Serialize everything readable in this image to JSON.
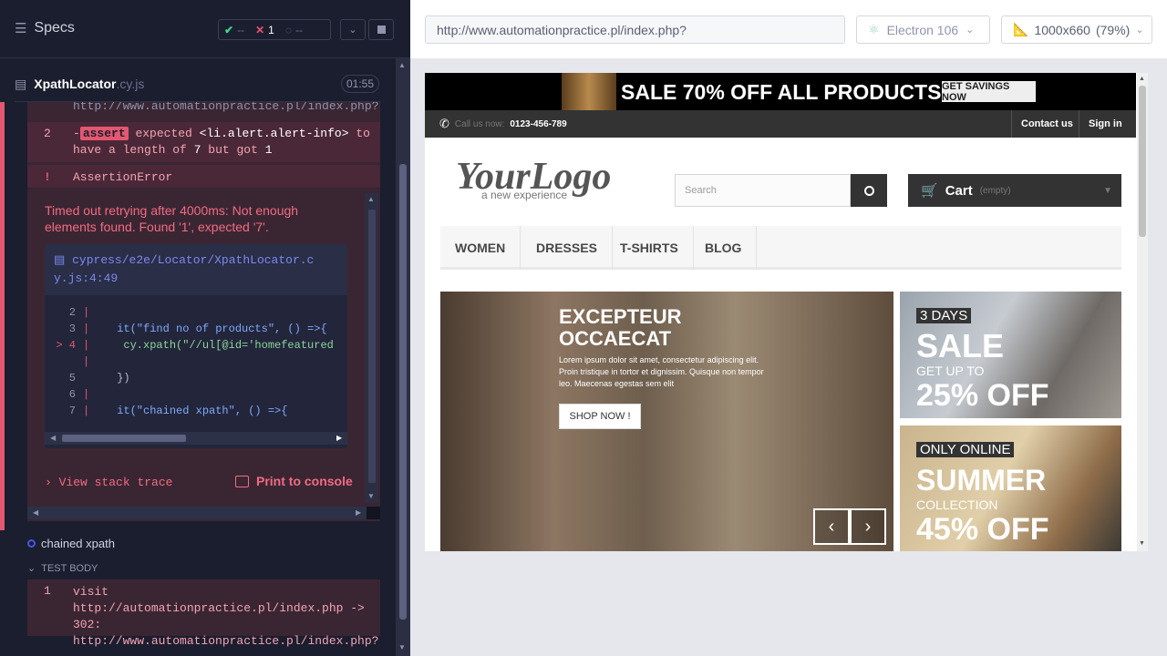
{
  "header": {
    "specs_label": "Specs",
    "passed": "--",
    "failed": "1",
    "pending": "--"
  },
  "spec_file": {
    "name": "XpathLocator",
    "ext": ".cy.js",
    "duration": "01:55"
  },
  "command_log": {
    "visit_prev_text": "http://www.automationpractice.pl/index.php?",
    "assert_row": {
      "num": "2",
      "prefix": "-",
      "badge": "assert",
      "text1": "expected",
      "selector": "<li.alert.alert-info>",
      "text2": "to",
      "line2": "have a length of",
      "expected": "7",
      "but": "but got",
      "got": "1"
    },
    "error_row": {
      "bang": "!",
      "type": "AssertionError"
    },
    "error_message": "Timed out retrying after 4000ms: Not enough elements found. Found '1', expected '7'.",
    "code_frame": {
      "file_line1": "cypress/e2e/Locator/XpathLocator.c",
      "file_line2": "y.js:4:49",
      "lines": [
        {
          "num": "2",
          "code": ""
        },
        {
          "num": "3",
          "code": "it(\"find no of products\", () =>{"
        },
        {
          "num": "4",
          "code": "    cy.xpath(\"//ul[@id='homefeatured"
        },
        {
          "num": "",
          "code": ""
        },
        {
          "num": "5",
          "code": "})"
        },
        {
          "num": "6",
          "code": ""
        },
        {
          "num": "7",
          "code": "it(\"chained xpath\", () =>{"
        }
      ]
    },
    "view_stack_trace": "View stack trace",
    "print_to_console": "Print to console"
  },
  "next_test": {
    "title": "chained xpath",
    "section": "TEST BODY",
    "visit": {
      "num": "1",
      "text": "visit  http://automationpractice.pl/index.php -> 302: http://www.automationpractice.pl/index.php?"
    }
  },
  "browser": {
    "url": "http://www.automationpractice.pl/index.php?",
    "browser_name": "Electron 106",
    "viewport": "1000x660",
    "zoom": "(79%)"
  },
  "site": {
    "banner_text": "SALE 70% OFF ALL PRODUCTS",
    "banner_button": "GET SAVINGS NOW",
    "call_label": "Call us now:",
    "phone": "0123-456-789",
    "contact": "Contact us",
    "signin": "Sign in",
    "logo": "YourLogo",
    "logo_tag": "a new experience",
    "search_placeholder": "Search",
    "cart_label": "Cart",
    "cart_state": "(empty)",
    "menu": [
      "WOMEN",
      "DRESSES",
      "T-SHIRTS",
      "BLOG"
    ],
    "slide": {
      "title": "EXCEPTEUR OCCAECAT",
      "text": "Lorem ipsum dolor sit amet, consectetur adipiscing elit. Proin tristique in tortor et dignissim. Quisque non tempor leo. Maecenas egestas sem elit",
      "button": "SHOP NOW !"
    },
    "promo1": {
      "tag": "3 DAYS",
      "big": "SALE",
      "small": "GET UP TO",
      "pct": "25% OFF"
    },
    "promo2": {
      "tag": "ONLY ONLINE",
      "big": "SUMMER",
      "small": "COLLECTION",
      "pct": "45% OFF"
    }
  }
}
